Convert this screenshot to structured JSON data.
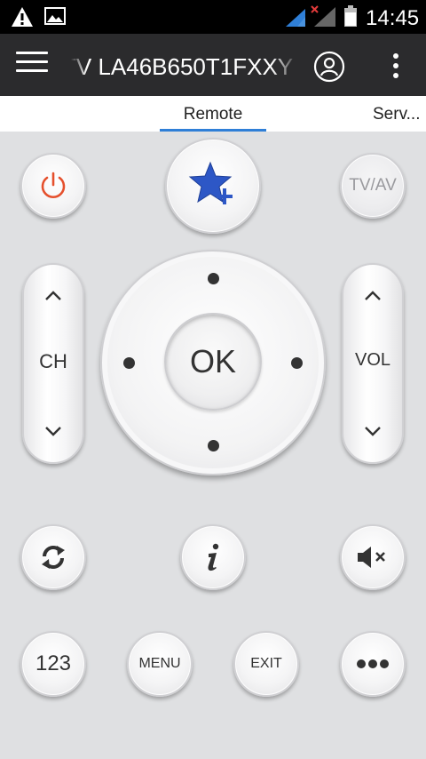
{
  "status_bar": {
    "time": "14:45"
  },
  "toolbar": {
    "title": "TV LA46B650T1FXXY"
  },
  "tabs": [
    {
      "label": "Remote",
      "selected": true
    },
    {
      "label": "Serv..."
    }
  ],
  "remote": {
    "tv_av_label": "TV/AV",
    "ch_label": "CH",
    "vol_label": "VOL",
    "ok_label": "OK",
    "num_label": "123",
    "menu_label": "MENU",
    "exit_label": "EXIT"
  },
  "colors": {
    "accent": "#2f7fd7",
    "power": "#e5502d",
    "star": "#2d57c6",
    "toolbar": "#2b2b2d",
    "background": "#dfe0e2"
  }
}
